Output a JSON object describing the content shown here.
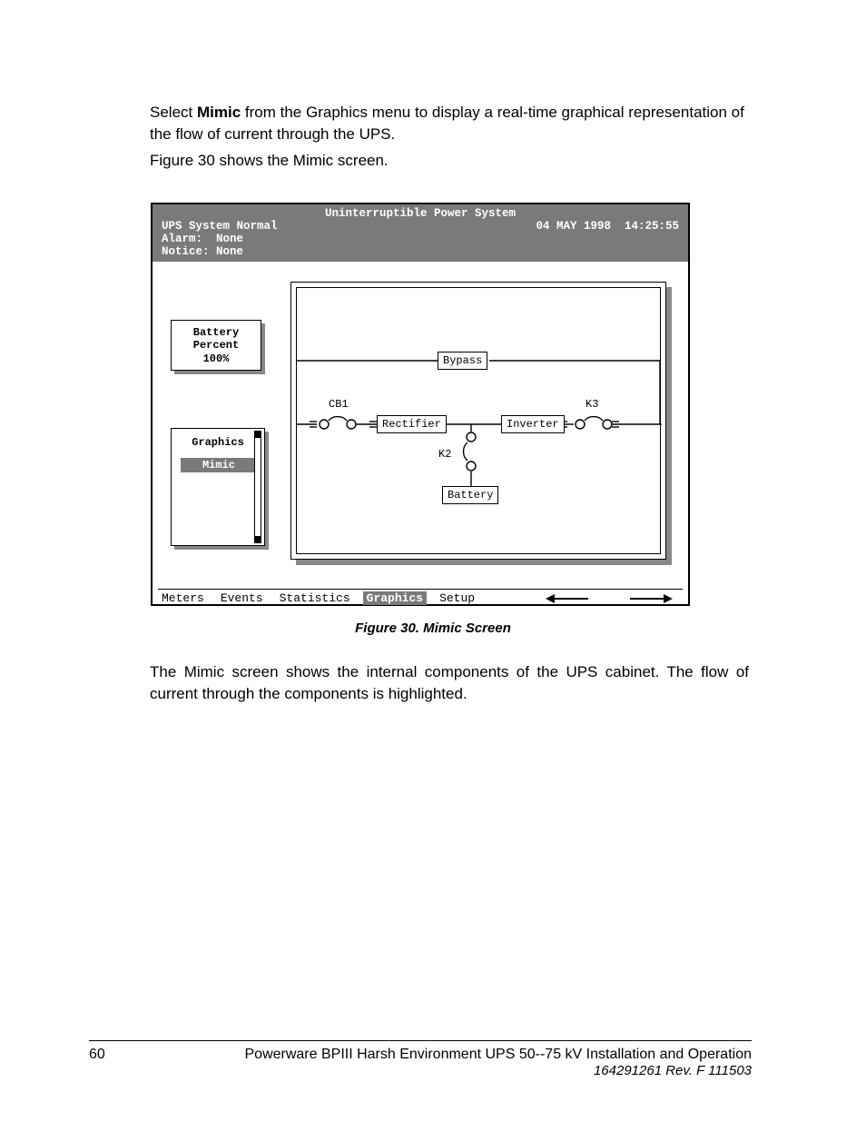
{
  "paragraphs": {
    "p1_pre": "Select ",
    "p1_bold": "Mimic",
    "p1_post": " from the Graphics menu to display a real-time graphical representation of the flow of current through the UPS.",
    "p2": "Figure 30 shows the Mimic screen.",
    "p_after": "The Mimic screen shows the internal components of the UPS cabinet.  The flow of current through the components is highlighted."
  },
  "figure_caption": "Figure 30.  Mimic Screen",
  "footer": {
    "page_number": "60",
    "title": "Powerware BPIII Harsh Environment UPS 50--75 kV Installation and Operation",
    "revision": "164291261 Rev. F  111503"
  },
  "screen": {
    "title": "Uninterruptible Power System",
    "status_line": "UPS System Normal",
    "date": "04 MAY 1998",
    "time": "14:25:55",
    "alarm_label": "Alarm:",
    "alarm_value": "None",
    "notice_label": "Notice:",
    "notice_value": "None",
    "battery_box_l1": "Battery",
    "battery_box_l2": "Percent",
    "battery_box_l3": "100%",
    "graphics_box_title": "Graphics",
    "graphics_selected_item": "Mimic",
    "menu": {
      "meters": "Meters",
      "events": "Events",
      "statistics": "Statistics",
      "graphics": "Graphics",
      "setup": "Setup"
    },
    "diagram": {
      "bypass": "Bypass",
      "rectifier": "Rectifier",
      "inverter": "Inverter",
      "battery": "Battery",
      "cb1": "CB1",
      "k2": "K2",
      "k3": "K3"
    }
  }
}
